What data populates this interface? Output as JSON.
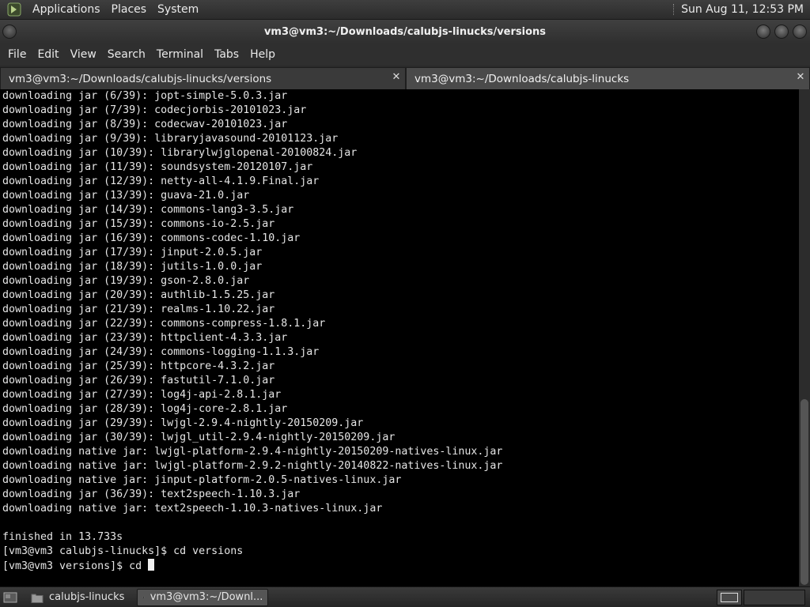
{
  "top_panel": {
    "menus": [
      "Applications",
      "Places",
      "System"
    ],
    "clock": "Sun Aug 11, 12:53 PM"
  },
  "window": {
    "title": "vm3@vm3:~/Downloads/calubjs-linucks/versions"
  },
  "menubar": [
    "File",
    "Edit",
    "View",
    "Search",
    "Terminal",
    "Tabs",
    "Help"
  ],
  "tabs": [
    {
      "label": "vm3@vm3:~/Downloads/calubjs-linucks/versions",
      "close": "✕"
    },
    {
      "label": "vm3@vm3:~/Downloads/calubjs-linucks",
      "close": "✕"
    }
  ],
  "terminal": {
    "lines": [
      "downloading jar (6/39): jopt-simple-5.0.3.jar",
      "downloading jar (7/39): codecjorbis-20101023.jar",
      "downloading jar (8/39): codecwav-20101023.jar",
      "downloading jar (9/39): libraryjavasound-20101123.jar",
      "downloading jar (10/39): librarylwjglopenal-20100824.jar",
      "downloading jar (11/39): soundsystem-20120107.jar",
      "downloading jar (12/39): netty-all-4.1.9.Final.jar",
      "downloading jar (13/39): guava-21.0.jar",
      "downloading jar (14/39): commons-lang3-3.5.jar",
      "downloading jar (15/39): commons-io-2.5.jar",
      "downloading jar (16/39): commons-codec-1.10.jar",
      "downloading jar (17/39): jinput-2.0.5.jar",
      "downloading jar (18/39): jutils-1.0.0.jar",
      "downloading jar (19/39): gson-2.8.0.jar",
      "downloading jar (20/39): authlib-1.5.25.jar",
      "downloading jar (21/39): realms-1.10.22.jar",
      "downloading jar (22/39): commons-compress-1.8.1.jar",
      "downloading jar (23/39): httpclient-4.3.3.jar",
      "downloading jar (24/39): commons-logging-1.1.3.jar",
      "downloading jar (25/39): httpcore-4.3.2.jar",
      "downloading jar (26/39): fastutil-7.1.0.jar",
      "downloading jar (27/39): log4j-api-2.8.1.jar",
      "downloading jar (28/39): log4j-core-2.8.1.jar",
      "downloading jar (29/39): lwjgl-2.9.4-nightly-20150209.jar",
      "downloading jar (30/39): lwjgl_util-2.9.4-nightly-20150209.jar",
      "downloading native jar: lwjgl-platform-2.9.4-nightly-20150209-natives-linux.jar",
      "downloading native jar: lwjgl-platform-2.9.2-nightly-20140822-natives-linux.jar",
      "downloading native jar: jinput-platform-2.0.5-natives-linux.jar",
      "downloading jar (36/39): text2speech-1.10.3.jar",
      "downloading native jar: text2speech-1.10.3-natives-linux.jar",
      "",
      "finished in 13.733s",
      "[vm3@vm3 calubjs-linucks]$ cd versions"
    ],
    "prompt": "[vm3@vm3 versions]$ cd "
  },
  "taskbar": {
    "items": [
      {
        "label": "calubjs-linucks",
        "icon": "folder-icon"
      },
      {
        "label": "vm3@vm3:~/Downl...",
        "icon": "terminal-icon"
      }
    ]
  }
}
